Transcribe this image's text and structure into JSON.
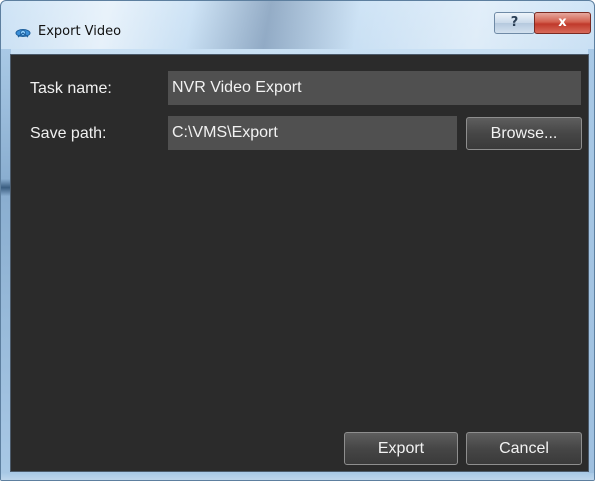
{
  "window": {
    "title": "Export Video",
    "help_label": "?",
    "close_label": "x"
  },
  "form": {
    "task_name_label": "Task name:",
    "task_name_value": "NVR Video Export",
    "save_path_label": "Save path:",
    "save_path_value": "C:\\VMS\\Export",
    "browse_label": "Browse..."
  },
  "actions": {
    "export_label": "Export",
    "cancel_label": "Cancel"
  },
  "icons": {
    "app": "app-icon"
  },
  "colors": {
    "client_bg": "#2b2b2b",
    "field_bg": "#505050",
    "text": "#f0f0f0",
    "close_button": "#c0392b",
    "title_bar": "#b7d3ec"
  }
}
